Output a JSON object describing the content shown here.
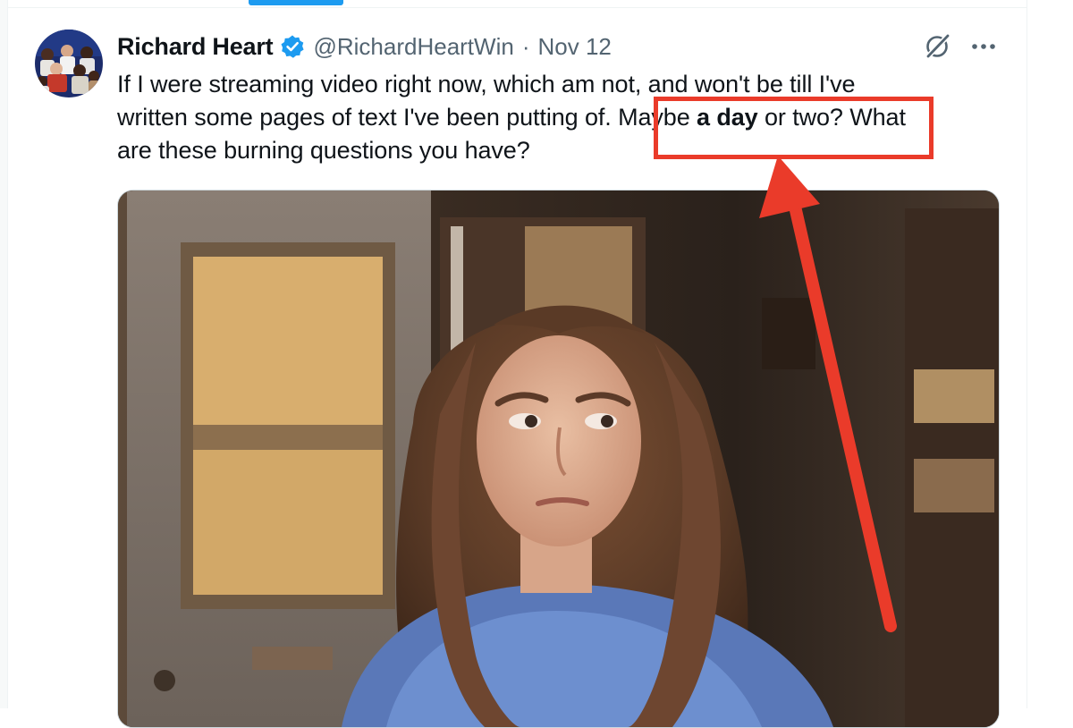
{
  "tweet": {
    "display_name": "Richard Heart",
    "handle": "@RichardHeartWin",
    "separator": "·",
    "date": "Nov 12",
    "text_lines": [
      {
        "a": "If I were streaming video right now, which am not, and won't be till I've"
      },
      {
        "a": "written some pages of text I've been putting of",
        "b": ". Maybe ",
        "c": "a day",
        "d": " or two?",
        "e": " What"
      },
      {
        "a": "are these burning questions you have?"
      }
    ]
  },
  "icons": {
    "verified": "verified-badge-icon",
    "grok": "grok-icon",
    "more": "more-options-icon"
  },
  "colors": {
    "accent": "#1d9bf0",
    "annotation": "#ea3b2a",
    "secondary_text": "#536471"
  }
}
